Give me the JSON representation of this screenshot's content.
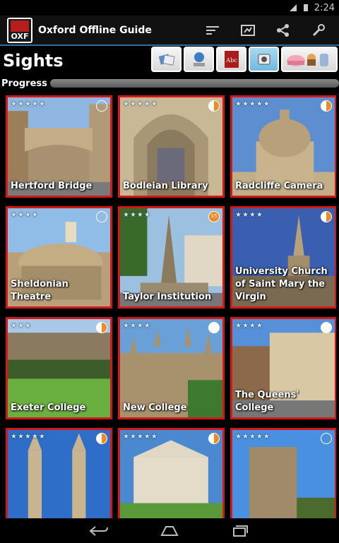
{
  "status": {
    "time": "2:24"
  },
  "app": {
    "title": "Oxford Offline Guide",
    "logo_text": "OXF"
  },
  "header": {
    "title": "Sights"
  },
  "categories": [
    {
      "name": "cards-icon"
    },
    {
      "name": "audio-guide-icon"
    },
    {
      "name": "dictionary-icon",
      "text": "Abc"
    },
    {
      "name": "camera-icon"
    },
    {
      "name": "food-drink-icon"
    }
  ],
  "progress": {
    "label": "Progress",
    "value": 0
  },
  "cards": [
    {
      "label": "Hertford Bridge",
      "stars": "★★★★★"
    },
    {
      "label": "Bodleian Library",
      "stars": "★★★★★"
    },
    {
      "label": "Radcliffe Camera",
      "stars": "★★★★★"
    },
    {
      "label": "Sheldonian Theatre",
      "stars": "★★★★"
    },
    {
      "label": "Taylor Institution",
      "stars": "★★★★",
      "badge_text": "15"
    },
    {
      "label": "University Church of Saint Mary the Virgin",
      "stars": "★★★★"
    },
    {
      "label": "Exeter College",
      "stars": "★★★"
    },
    {
      "label": "New College",
      "stars": "★★★★"
    },
    {
      "label": "The Queens' College",
      "stars": "★★★★"
    },
    {
      "label": "",
      "stars": "★★★★★"
    },
    {
      "label": "",
      "stars": "★★★★★"
    },
    {
      "label": "",
      "stars": "★★★★★"
    }
  ],
  "colors": {
    "accent": "#2a6fa8",
    "card_border": "#d11919",
    "badge": "#f08a24"
  }
}
